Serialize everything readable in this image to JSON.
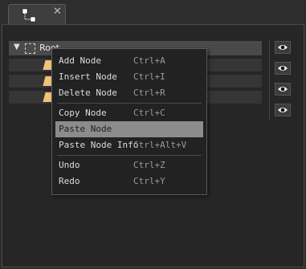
{
  "tab": {
    "icon": "node-graph-icon",
    "close_label": "✕"
  },
  "tree": {
    "root_label": "Root",
    "children": [
      {
        "icon": "node-icon"
      },
      {
        "icon": "node-icon"
      },
      {
        "icon": "node-icon"
      }
    ]
  },
  "visibility": {
    "icon": "eye-icon",
    "count": 4
  },
  "context_menu": {
    "groups": [
      [
        {
          "label": "Add Node",
          "shortcut": "Ctrl+A"
        },
        {
          "label": "Insert Node",
          "shortcut": "Ctrl+I"
        },
        {
          "label": "Delete Node",
          "shortcut": "Ctrl+R"
        }
      ],
      [
        {
          "label": "Copy Node",
          "shortcut": "Ctrl+C"
        },
        {
          "label": "Paste Node",
          "shortcut": "",
          "highlighted": true
        },
        {
          "label": "Paste Node Info",
          "shortcut": "Ctrl+Alt+V"
        }
      ],
      [
        {
          "label": "Undo",
          "shortcut": "Ctrl+Z"
        },
        {
          "label": "Redo",
          "shortcut": "Ctrl+Y"
        }
      ]
    ]
  },
  "colors": {
    "node_icon": "#f3c27b",
    "highlight": "#8c8c8c"
  }
}
